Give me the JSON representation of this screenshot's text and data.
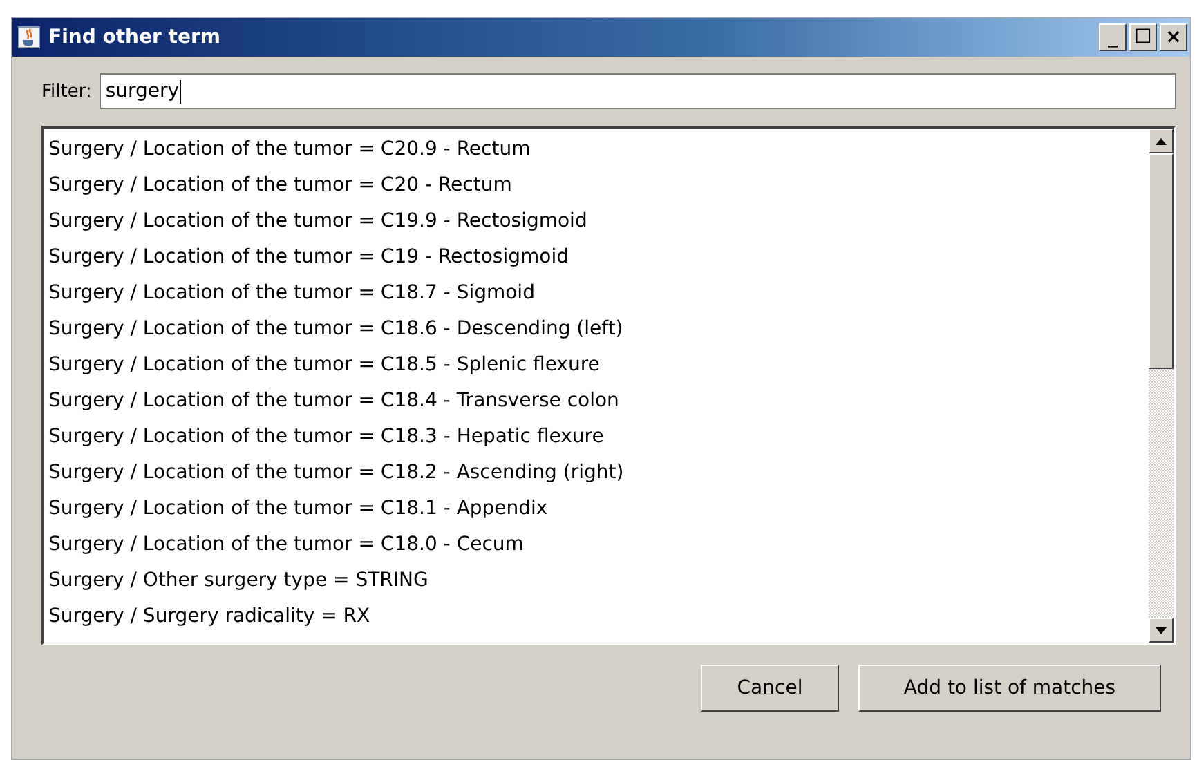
{
  "window": {
    "title": "Find other term",
    "controls": [
      "_",
      "☐",
      "×"
    ]
  },
  "filter": {
    "label": "Filter:",
    "value": "surgery"
  },
  "list": {
    "items": [
      {
        "text": "Surgery / Location of the tumor = C20.9 - Rectum",
        "selected": false
      },
      {
        "text": "Surgery / Location of the tumor = C20 - Rectum",
        "selected": false
      },
      {
        "text": "Surgery / Location of the tumor = C19.9 - Rectosigmoid",
        "selected": false
      },
      {
        "text": "Surgery / Location of the tumor = C19 - Rectosigmoid",
        "selected": false
      },
      {
        "text": "Surgery / Location of the tumor = C18.7 - Sigmoid",
        "selected": false
      },
      {
        "text": "Surgery / Location of the tumor = C18.6 - Descending (left)",
        "selected": false
      },
      {
        "text": "Surgery / Location of the tumor = C18.5 - Splenic flexure",
        "selected": false
      },
      {
        "text": "Surgery / Location of the tumor = C18.4 - Transverse colon",
        "selected": false
      },
      {
        "text": "Surgery / Location of the tumor = C18.3 - Hepatic flexure",
        "selected": false
      },
      {
        "text": "Surgery / Location of the tumor = C18.2 - Ascending (right)",
        "selected": false
      },
      {
        "text": "Surgery / Location of the tumor = C18.1 - Appendix",
        "selected": false
      },
      {
        "text": "Surgery / Location of the tumor = C18.0 - Cecum",
        "selected": false
      },
      {
        "text": "Surgery / Other surgery type = STRING",
        "selected": false
      },
      {
        "text": "Surgery / Surgery radicality = RX",
        "selected": false
      }
    ]
  },
  "buttons": [
    "Cancel",
    "Add to list of matches"
  ]
}
